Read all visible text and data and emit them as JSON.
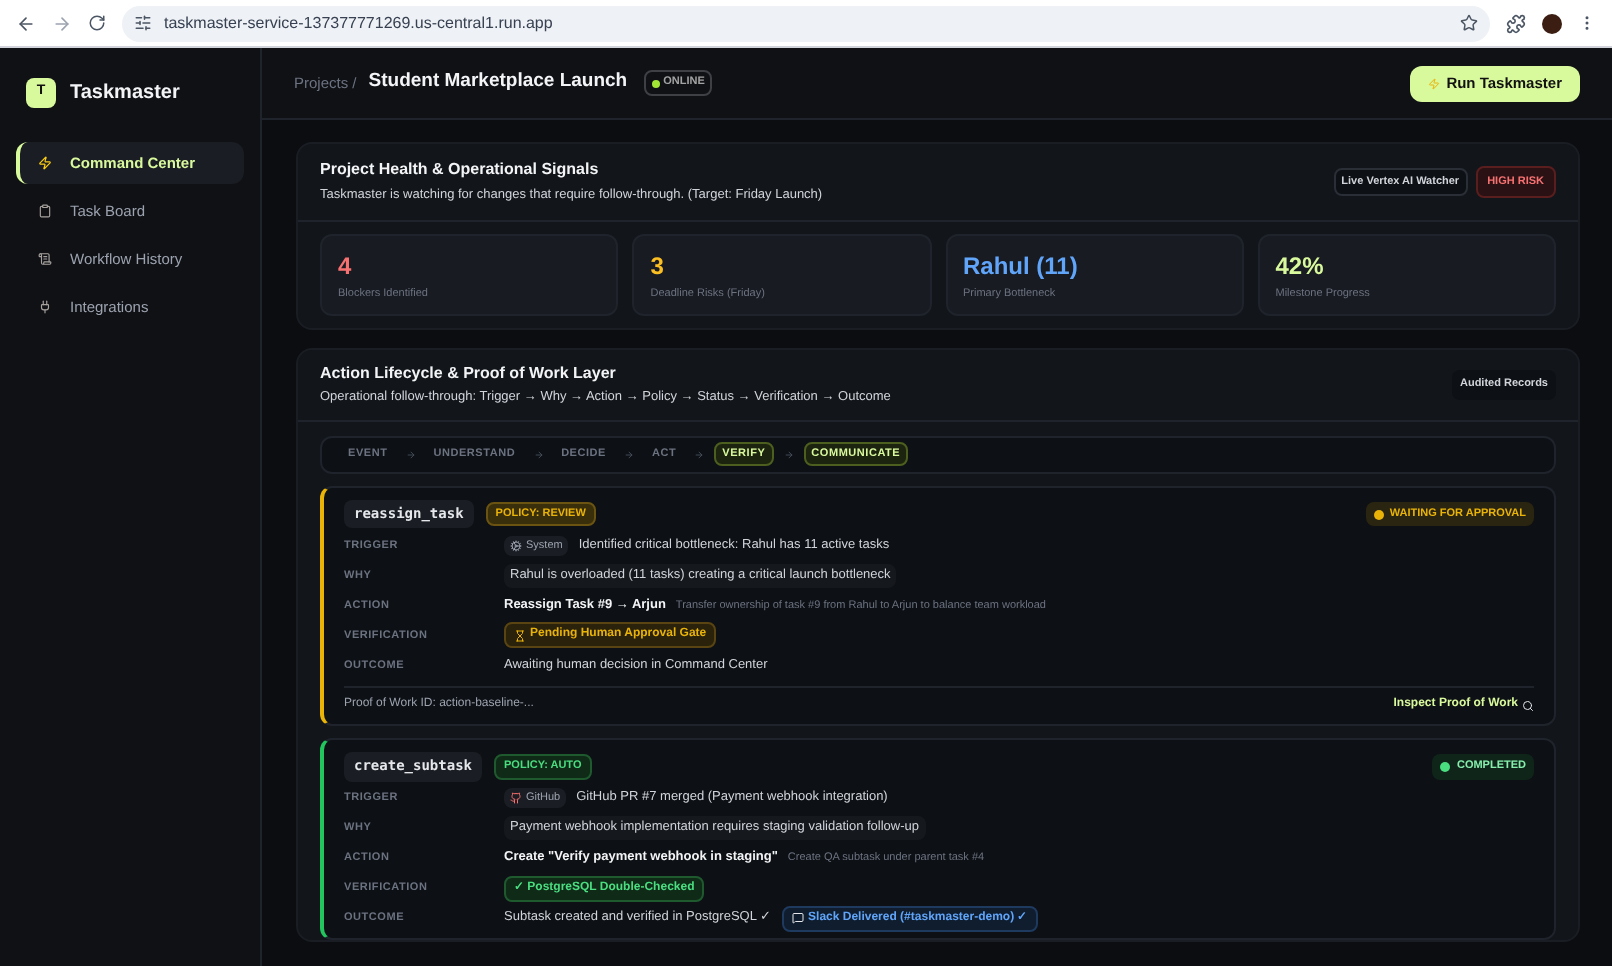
{
  "browser": {
    "url": "taskmaster-service-137377771269.us-central1.run.app"
  },
  "sidebar": {
    "app_name": "Taskmaster",
    "logo_letter": "T",
    "items": [
      {
        "label": "Command Center",
        "selected": true
      },
      {
        "label": "Task Board",
        "selected": false
      },
      {
        "label": "Workflow History",
        "selected": false
      },
      {
        "label": "Integrations",
        "selected": false
      }
    ]
  },
  "header": {
    "breadcrumb": "Projects /",
    "title": "Student Marketplace Launch",
    "status": "ONLINE",
    "run_button": "Run Taskmaster"
  },
  "health": {
    "title": "Project Health & Operational Signals",
    "subtitle": "Taskmaster is watching for changes that require follow-through. (Target: Friday Launch)",
    "watcher_badge": "Live Vertex AI Watcher",
    "risk_badge": "HIGH RISK",
    "metrics": [
      {
        "value": "4",
        "label": "Blockers Identified",
        "color": "#f87171"
      },
      {
        "value": "3",
        "label": "Deadline Risks (Friday)",
        "color": "#fbbf24"
      },
      {
        "value": "Rahul (11)",
        "label": "Primary Bottleneck",
        "color": "#60a5fa"
      },
      {
        "value": "42%",
        "label": "Milestone Progress",
        "color": "#d9f99d"
      }
    ]
  },
  "lifecycle": {
    "title": "Action Lifecycle & Proof of Work Layer",
    "subtitle": "Operational follow-through: Trigger → Why → Action → Policy → Status → Verification → Outcome",
    "records_badge": "Audited Records",
    "steps": [
      {
        "label": "EVENT",
        "active": false
      },
      {
        "label": "UNDERSTAND",
        "active": false
      },
      {
        "label": "DECIDE",
        "active": false
      },
      {
        "label": "ACT",
        "active": false
      },
      {
        "label": "VERIFY",
        "active": true
      },
      {
        "label": "COMMUNICATE",
        "active": true
      }
    ],
    "actions": [
      {
        "kind": "pending",
        "name": "reassign_task",
        "policy": "POLICY: REVIEW",
        "status": "WAITING FOR APPROVAL",
        "trigger_label": "TRIGGER",
        "trigger_source": {
          "kind": "system",
          "label": "System"
        },
        "trigger_text": "Identified critical bottleneck: Rahul has 11 active tasks",
        "why_label": "WHY",
        "why": "Rahul is overloaded (11 tasks) creating a critical launch bottleneck",
        "action_label": "ACTION",
        "action_title": "Reassign Task #9 → Arjun",
        "action_detail": "Transfer ownership of task #9 from Rahul to Arjun to balance team workload",
        "verification_label": "VERIFICATION",
        "verification": "Pending Human Approval Gate",
        "outcome_label": "OUTCOME",
        "outcome": "Awaiting human decision in Command Center",
        "proof_id": "Proof of Work ID: action-baseline-...",
        "inspect_link": "Inspect Proof of Work"
      },
      {
        "kind": "completed",
        "name": "create_subtask",
        "policy": "POLICY: AUTO",
        "status": "COMPLETED",
        "trigger_label": "TRIGGER",
        "trigger_source": {
          "kind": "github",
          "label": "GitHub"
        },
        "trigger_text": "GitHub PR #7 merged (Payment webhook integration)",
        "why_label": "WHY",
        "why": "Payment webhook implementation requires staging validation follow-up",
        "action_label": "ACTION",
        "action_title": "Create \"Verify payment webhook in staging\"",
        "action_detail": "Create QA subtask under parent task #4",
        "verification_label": "VERIFICATION",
        "verification": "✓ PostgreSQL Double-Checked",
        "outcome_label": "OUTCOME",
        "outcome": "Subtask created and verified in PostgreSQL ✓",
        "outcome_badge": "Slack Delivered (#taskmaster-demo) ✓"
      }
    ]
  }
}
